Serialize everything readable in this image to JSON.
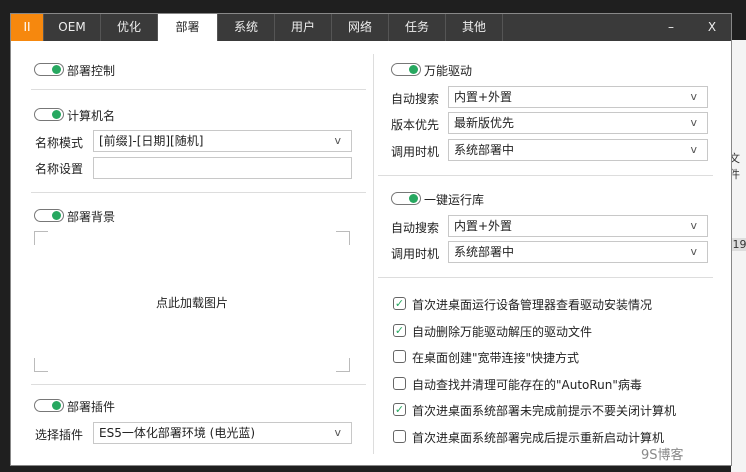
{
  "tabs": [
    {
      "label": "II"
    },
    {
      "label": "OEM"
    },
    {
      "label": "优化"
    },
    {
      "label": "部署"
    },
    {
      "label": "系统"
    },
    {
      "label": "用户"
    },
    {
      "label": "网络"
    },
    {
      "label": "任务"
    },
    {
      "label": "其他"
    }
  ],
  "window": {
    "minimize": "–",
    "close": "X"
  },
  "left": {
    "deploy_control": {
      "label": "部署控制",
      "on": true
    },
    "computer_name": {
      "label": "计算机名",
      "on": true,
      "mode_label": "名称模式",
      "mode_value": "[前缀]-[日期][随机]",
      "name_label": "名称设置",
      "name_value": ""
    },
    "background": {
      "label": "部署背景",
      "on": true,
      "placeholder": "点此加载图片"
    },
    "plugin": {
      "label": "部署插件",
      "on": true,
      "select_label": "选择插件",
      "select_value": "ES5一体化部署环境 (电光蓝)"
    }
  },
  "right": {
    "driver": {
      "label": "万能驱动",
      "on": true,
      "rows": [
        {
          "label": "自动搜索",
          "value": "内置+外置"
        },
        {
          "label": "版本优先",
          "value": "最新版优先"
        },
        {
          "label": "调用时机",
          "value": "系统部署中"
        }
      ]
    },
    "runtime": {
      "label": "一键运行库",
      "on": true,
      "rows": [
        {
          "label": "自动搜索",
          "value": "内置+外置"
        },
        {
          "label": "调用时机",
          "value": "系统部署中"
        }
      ]
    },
    "options": [
      {
        "label": "首次进桌面运行设备管理器查看驱动安装情况",
        "checked": true
      },
      {
        "label": "自动删除万能驱动解压的驱动文件",
        "checked": true
      },
      {
        "label": "在桌面创建\"宽带连接\"快捷方式",
        "checked": false
      },
      {
        "label": "自动查找并清理可能存在的\"AutoRun\"病毒",
        "checked": false
      },
      {
        "label": "首次进桌面系统部署未完成前提示不要关闭计算机",
        "checked": true
      },
      {
        "label": "首次进桌面系统部署完成后提示重新启动计算机",
        "checked": false
      }
    ]
  },
  "background_app": {
    "text1": "文件",
    "text2": ".19"
  },
  "watermark": "9S博客",
  "chevron": "v",
  "check": "✓"
}
